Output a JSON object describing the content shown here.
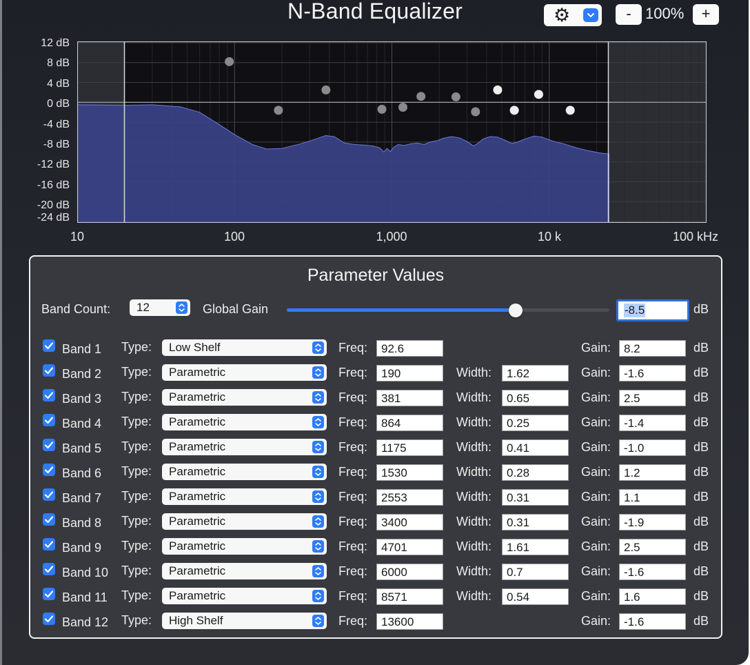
{
  "window": {
    "title": "N-Band Equalizer"
  },
  "toolbar": {
    "settings_icon": "gear-icon",
    "zoom_out_label": "-",
    "zoom_level": "100%",
    "zoom_in_label": "+"
  },
  "graph": {
    "y_tick_labels": [
      "12 dB",
      "8 dB",
      "4 dB",
      "0 dB",
      "-4 dB",
      "-8 dB",
      "-12 dB",
      "-16 dB",
      "-20 dB",
      "-24 dB"
    ],
    "y_range_db": [
      -24,
      12
    ],
    "x_tick_labels": [
      "10",
      "100",
      "1,000",
      "10 k",
      "100 kHz"
    ],
    "x_range_hz": [
      10,
      100000
    ],
    "x_scale": "log",
    "band_handles": [
      {
        "freq": 92.6,
        "gain": 8.2
      },
      {
        "freq": 190,
        "gain": -1.6
      },
      {
        "freq": 381,
        "gain": 2.5
      },
      {
        "freq": 864,
        "gain": -1.4
      },
      {
        "freq": 1175,
        "gain": -1.0
      },
      {
        "freq": 1530,
        "gain": 1.2
      },
      {
        "freq": 2553,
        "gain": 1.1
      },
      {
        "freq": 3400,
        "gain": -1.9
      },
      {
        "freq": 4701,
        "gain": 2.5
      },
      {
        "freq": 6000,
        "gain": -1.6
      },
      {
        "freq": 8571,
        "gain": 1.6
      },
      {
        "freq": 13600,
        "gain": -1.6
      }
    ],
    "spectrum": [
      [
        10,
        -0.5
      ],
      [
        20,
        -0.6
      ],
      [
        30,
        -0.5
      ],
      [
        45,
        -0.9
      ],
      [
        60,
        -2.0
      ],
      [
        80,
        -4.5
      ],
      [
        100,
        -6.5
      ],
      [
        130,
        -8.5
      ],
      [
        160,
        -9.4
      ],
      [
        200,
        -9.3
      ],
      [
        260,
        -8.4
      ],
      [
        320,
        -7.5
      ],
      [
        380,
        -6.7
      ],
      [
        430,
        -6.9
      ],
      [
        500,
        -8.2
      ],
      [
        580,
        -8.5
      ],
      [
        660,
        -8.6
      ],
      [
        760,
        -8.8
      ],
      [
        840,
        -9.2
      ],
      [
        890,
        -10.0
      ],
      [
        930,
        -9.3
      ],
      [
        980,
        -9.9
      ],
      [
        1030,
        -9.0
      ],
      [
        1100,
        -8.5
      ],
      [
        1200,
        -8.7
      ],
      [
        1300,
        -8.4
      ],
      [
        1450,
        -8.2
      ],
      [
        1600,
        -8.5
      ],
      [
        1750,
        -8.0
      ],
      [
        1950,
        -7.7
      ],
      [
        2150,
        -7.2
      ],
      [
        2400,
        -6.9
      ],
      [
        2700,
        -7.2
      ],
      [
        3000,
        -7.9
      ],
      [
        3300,
        -8.8
      ],
      [
        3500,
        -8.3
      ],
      [
        3800,
        -7.4
      ],
      [
        4200,
        -6.9
      ],
      [
        4700,
        -7.0
      ],
      [
        5200,
        -7.6
      ],
      [
        5800,
        -8.3
      ],
      [
        6300,
        -8.0
      ],
      [
        7000,
        -7.4
      ],
      [
        8000,
        -6.8
      ],
      [
        9000,
        -7.0
      ],
      [
        10500,
        -7.8
      ],
      [
        12500,
        -8.4
      ],
      [
        15000,
        -9.2
      ],
      [
        18000,
        -9.8
      ],
      [
        21000,
        -10.2
      ],
      [
        24000,
        -10.4
      ]
    ],
    "colors": {
      "fill": "#3a4288",
      "line": "#6d78d8",
      "handle_selected": "#eeeeee",
      "handle": "#8a8a8a"
    }
  },
  "panel": {
    "title": "Parameter Values",
    "band_count_label": "Band Count:",
    "band_count_value": "12",
    "global_gain_label": "Global Gain",
    "global_gain_value": "-8.5",
    "global_gain_unit": "dB",
    "global_gain_slider_fraction": 0.71,
    "labels": {
      "type": "Type:",
      "freq": "Freq:",
      "width": "Width:",
      "gain": "Gain:",
      "unit": "dB"
    },
    "bands": [
      {
        "name": "Band 1",
        "enabled": true,
        "type": "Low Shelf",
        "freq": "92.6",
        "width": "",
        "gain": "8.2"
      },
      {
        "name": "Band 2",
        "enabled": true,
        "type": "Parametric",
        "freq": "190",
        "width": "1.62",
        "gain": "-1.6"
      },
      {
        "name": "Band 3",
        "enabled": true,
        "type": "Parametric",
        "freq": "381",
        "width": "0.65",
        "gain": "2.5"
      },
      {
        "name": "Band 4",
        "enabled": true,
        "type": "Parametric",
        "freq": "864",
        "width": "0.25",
        "gain": "-1.4"
      },
      {
        "name": "Band 5",
        "enabled": true,
        "type": "Parametric",
        "freq": "1175",
        "width": "0.41",
        "gain": "-1.0"
      },
      {
        "name": "Band 6",
        "enabled": true,
        "type": "Parametric",
        "freq": "1530",
        "width": "0.28",
        "gain": "1.2"
      },
      {
        "name": "Band 7",
        "enabled": true,
        "type": "Parametric",
        "freq": "2553",
        "width": "0.31",
        "gain": "1.1"
      },
      {
        "name": "Band 8",
        "enabled": true,
        "type": "Parametric",
        "freq": "3400",
        "width": "0.31",
        "gain": "-1.9"
      },
      {
        "name": "Band 9",
        "enabled": true,
        "type": "Parametric",
        "freq": "4701",
        "width": "1.61",
        "gain": "2.5"
      },
      {
        "name": "Band 10",
        "enabled": true,
        "type": "Parametric",
        "freq": "6000",
        "width": "0.7",
        "gain": "-1.6"
      },
      {
        "name": "Band 11",
        "enabled": true,
        "type": "Parametric",
        "freq": "8571",
        "width": "0.54",
        "gain": "1.6"
      },
      {
        "name": "Band 12",
        "enabled": true,
        "type": "High Shelf",
        "freq": "13600",
        "width": "",
        "gain": "-1.6"
      }
    ]
  }
}
